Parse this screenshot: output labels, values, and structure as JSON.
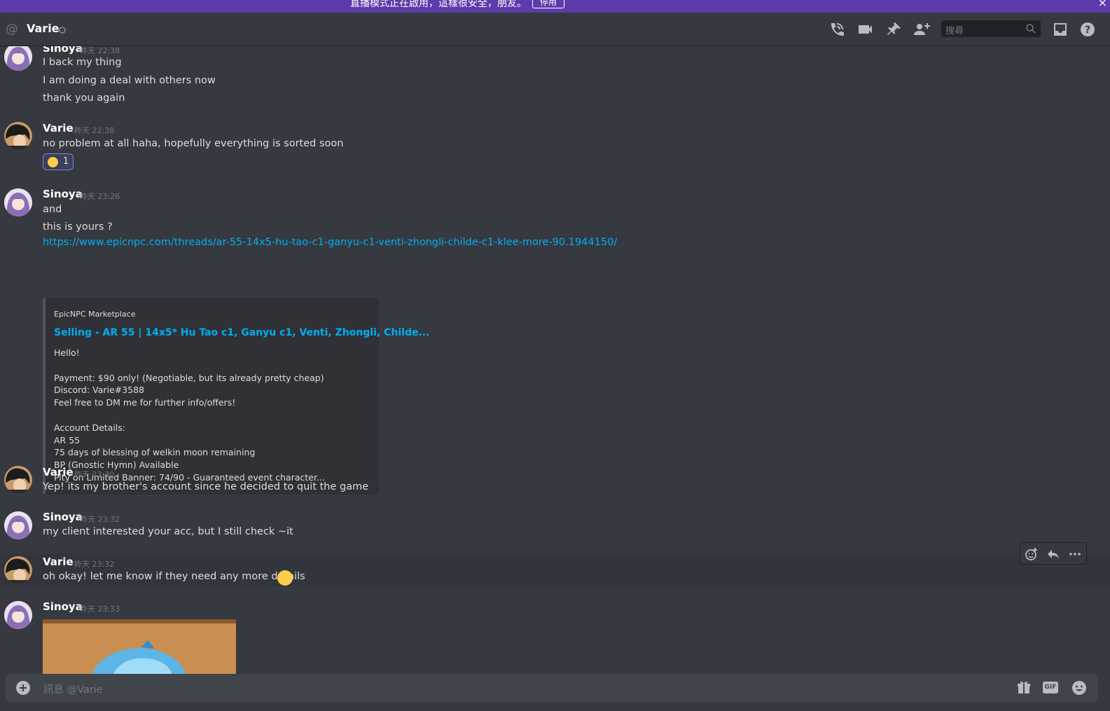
{
  "banner": {
    "text": "直播模式正在啟用，這樣很安全，朋友。",
    "button": "停用",
    "close": "×"
  },
  "header": {
    "title": "Varie",
    "search_placeholder": "搜尋"
  },
  "messages": [
    {
      "author": "Sinoya",
      "time": "昨天 22:38",
      "lines": [
        "I back my thing",
        "I am doing a deal with others now",
        "thank you again"
      ]
    },
    {
      "author": "Varie",
      "time": "昨天 22:38",
      "lines": [
        "no problem at all haha, hopefully everything is sorted soon"
      ],
      "reaction": {
        "emoji": "smiling-face",
        "count": "1"
      }
    },
    {
      "author": "Sinoya",
      "time": "昨天 23:26",
      "lines": [
        "and",
        "this is yours ?"
      ],
      "link": "https://www.epicnpc.com/threads/ar-55-14x5-hu-tao-c1-ganyu-c1-venti-zhongli-childe-c1-klee-more-90.1944150/"
    },
    {
      "author": "Varie",
      "time": "昨天 23:30",
      "lines": [
        "Yep! its my brother's account since he decided to quit the game"
      ]
    },
    {
      "author": "Sinoya",
      "time": "昨天 23:32",
      "lines": [
        "my client interested your acc, but I still check ~it"
      ]
    },
    {
      "author": "Varie",
      "time": "昨天 23:32",
      "lines": [
        "oh okay! let me know if they need any more details"
      ]
    },
    {
      "author": "Sinoya",
      "time": "昨天 23:33",
      "lines": []
    }
  ],
  "embed": {
    "provider": "EpicNPC Marketplace",
    "title": "Selling - AR 55 | 14x5* Hu Tao c1, Ganyu c1, Venti, Zhongli, Childe...",
    "lines": [
      "Hello!",
      "",
      "Payment: $90 only! (Negotiable, but its already pretty cheap)",
      "Discord: Varie#3588",
      "Feel free to DM me for further info/offers!",
      "",
      "Account Details:",
      "AR 55",
      "75 days of blessing of welkin moon remaining",
      "BP (Gnostic Hymn) Available",
      "Pity on Limited Banner: 74/90 - Guaranteed event character..."
    ]
  },
  "composer": {
    "placeholder": "訊息 @Varie",
    "gif_label": "GIF"
  },
  "colors": {
    "background": "#36393f",
    "banner": "#5d3bab",
    "link": "#00aff4",
    "reaction_border": "#7289da"
  }
}
